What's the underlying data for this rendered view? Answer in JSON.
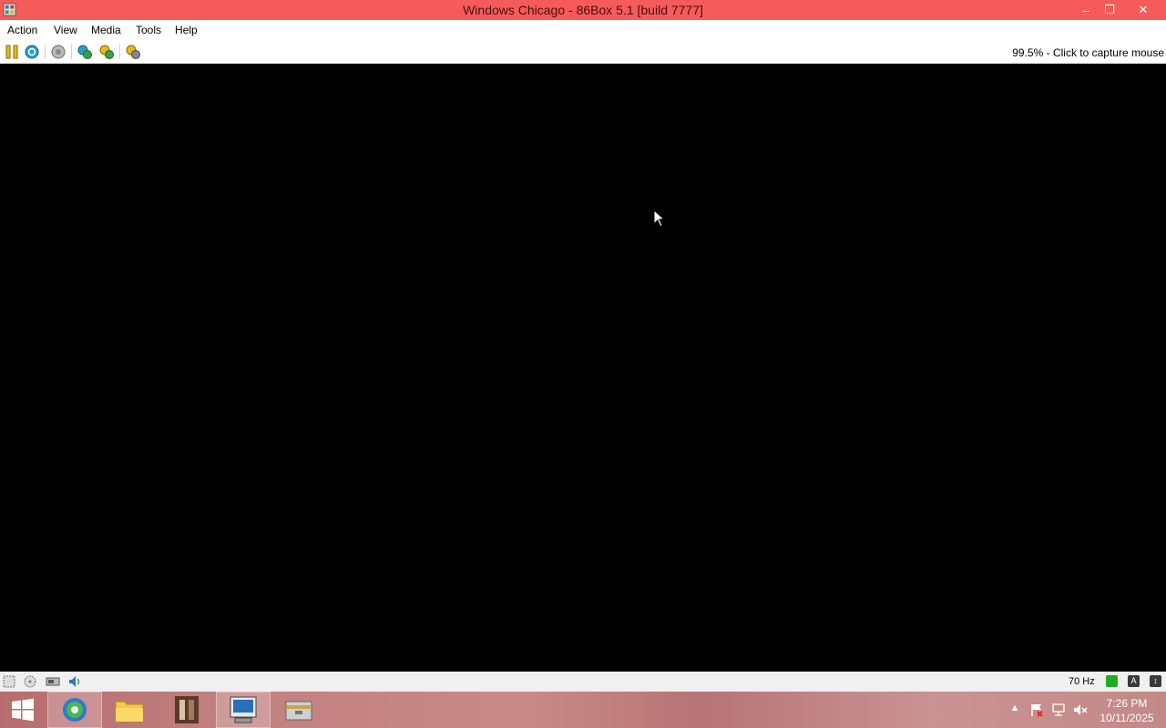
{
  "window": {
    "title": "Windows Chicago - 86Box 5.1 [build 7777]",
    "controls": {
      "minimize": "–",
      "maximize": "❐",
      "close": "✕"
    }
  },
  "menu": [
    "Action",
    "View",
    "Media",
    "Tools",
    "Help"
  ],
  "toolbar": {
    "buttons": [
      "pause-icon",
      "reset-icon",
      "ctrl-alt-del-icon",
      "settings-icon",
      "ctrl-alt-esc-icon",
      "hard-reset-icon"
    ],
    "status_text": "99.5% - Click to capture mouse"
  },
  "statusbar": {
    "icons": [
      "floppy-icon",
      "cdrom-icon",
      "hdd-icon",
      "sound-icon"
    ],
    "refresh_rate": "70 Hz",
    "indicators": [
      {
        "label": "",
        "color": "#22aa22"
      },
      {
        "label": "A",
        "color": "#3a3a3a"
      },
      {
        "label": "↕",
        "color": "#3a3a3a"
      }
    ]
  },
  "taskbar": {
    "items": [
      "start-button",
      "browser-icon",
      "file-explorer-icon",
      "app-icon",
      "86box-icon",
      "archive-icon"
    ],
    "tray": [
      "show-hidden-icon",
      "action-center-icon",
      "network-icon",
      "volume-muted-icon"
    ],
    "time": "7:26 PM",
    "date": "10/11/2025"
  },
  "colors": {
    "titlebar": "#f65b5b",
    "display": "#000000",
    "statusbar": "#f0f0f0"
  }
}
